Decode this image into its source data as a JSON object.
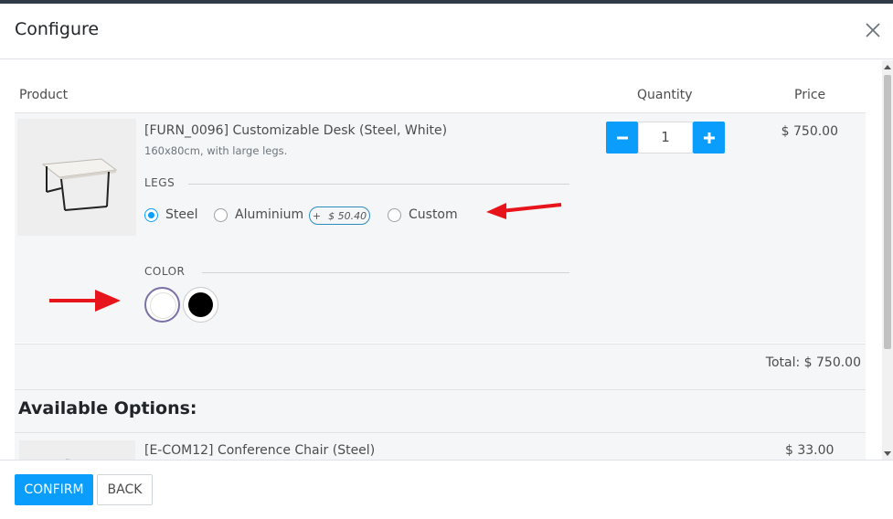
{
  "dialog": {
    "title": "Configure"
  },
  "table": {
    "columns": [
      "Product",
      "Quantity",
      "Price"
    ]
  },
  "product": {
    "name": "[FURN_0096] Customizable Desk (Steel, White)",
    "description": "160x80cm, with large legs.",
    "quantity": "1",
    "price": "$ 750.00",
    "attributes": {
      "legs": {
        "label": "LEGS",
        "options": [
          {
            "label": "Steel",
            "selected": true
          },
          {
            "label": "Aluminium",
            "selected": false,
            "extra_sign": "+",
            "extra_price": "$ 50.40"
          },
          {
            "label": "Custom",
            "selected": false
          }
        ]
      },
      "color": {
        "label": "COLOR",
        "options": [
          {
            "name": "white",
            "hex": "#ffffff",
            "selected": true
          },
          {
            "name": "black",
            "hex": "#000000",
            "selected": false
          }
        ]
      }
    }
  },
  "total": "Total: $ 750.00",
  "available_options": {
    "heading": "Available Options:",
    "items": [
      {
        "name": "[E-COM12] Conference Chair (Steel)",
        "price": "$ 33.00"
      }
    ]
  },
  "footer": {
    "confirm_label": "CONFIRM",
    "back_label": "BACK"
  },
  "colors": {
    "accent": "#0a9dfc",
    "annotation_arrow": "#e8141b"
  },
  "icons": {
    "close": "close-icon",
    "minus": "minus-icon",
    "plus": "plus-icon",
    "annotation": "arrow-annotation"
  }
}
